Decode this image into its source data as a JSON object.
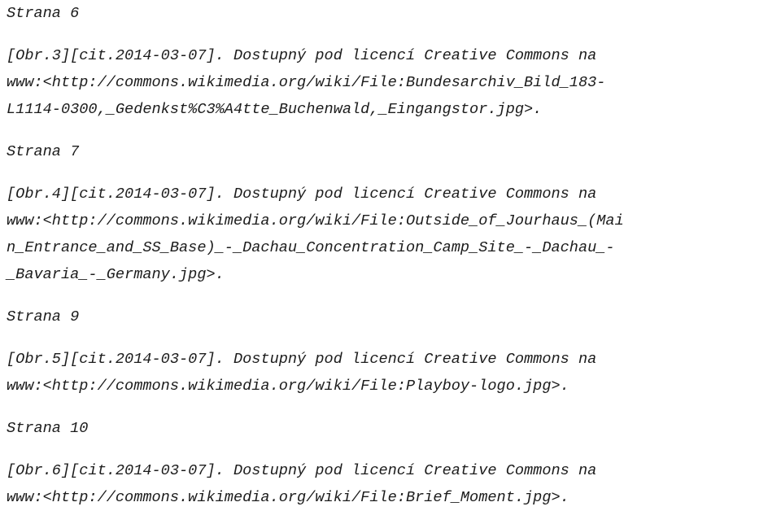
{
  "document": {
    "kind": "citation-list",
    "language": "cs",
    "page_heading_prefix": "Strana",
    "background_color": "#ffffff",
    "text_color": "#1c1c1c"
  },
  "sections": [
    {
      "heading": "Strana 6",
      "citation_lines": [
        "[Obr.3][cit.2014-03-07]. Dostupný pod licencí Creative Commons na",
        "www:<http://commons.wikimedia.org/wiki/File:Bundesarchiv_Bild_183-",
        "L1114-0300,_Gedenkst%C3%A4tte_Buchenwald,_Eingangstor.jpg>."
      ],
      "figure_ref": "[Obr.3]",
      "cited_date": "2014-03-07",
      "license": "Creative Commons",
      "file_name": "Bundesarchiv_Bild_183-L1114-0300,_Gedenkst%C3%A4tte_Buchenwald,_Eingangstor.jpg"
    },
    {
      "heading": "Strana 7",
      "citation_lines": [
        "[Obr.4][cit.2014-03-07]. Dostupný pod licencí Creative Commons na",
        "www:<http://commons.wikimedia.org/wiki/File:Outside_of_Jourhaus_(Mai",
        "n_Entrance_and_SS_Base)_-_Dachau_Concentration_Camp_Site_-_Dachau_-",
        "_Bavaria_-_Germany.jpg>."
      ],
      "figure_ref": "[Obr.4]",
      "cited_date": "2014-03-07",
      "license": "Creative Commons",
      "file_name": "Outside_of_Jourhaus_(Main_Entrance_and_SS_Base)_-_Dachau_Concentration_Camp_Site_-_Dachau_-_Bavaria_-_Germany.jpg"
    },
    {
      "heading": "Strana 9",
      "citation_lines": [
        "[Obr.5][cit.2014-03-07]. Dostupný pod licencí Creative Commons na",
        "www:<http://commons.wikimedia.org/wiki/File:Playboy-logo.jpg>."
      ],
      "figure_ref": "[Obr.5]",
      "cited_date": "2014-03-07",
      "license": "Creative Commons",
      "file_name": "Playboy-logo.jpg"
    },
    {
      "heading": "Strana 10",
      "citation_lines": [
        "[Obr.6][cit.2014-03-07]. Dostupný pod licencí Creative Commons na",
        "www:<http://commons.wikimedia.org/wiki/File:Brief_Moment.jpg>."
      ],
      "figure_ref": "[Obr.6]",
      "cited_date": "2014-03-07",
      "license": "Creative Commons",
      "file_name": "Brief_Moment.jpg"
    }
  ]
}
